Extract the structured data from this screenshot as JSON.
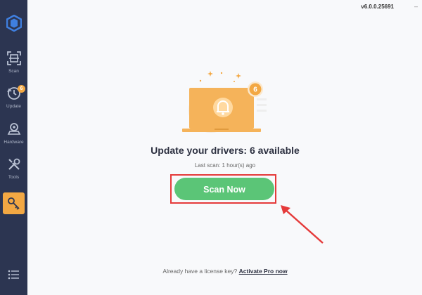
{
  "app": {
    "version": "v6.0.0.25691"
  },
  "sidebar": {
    "items": [
      {
        "label": "Scan",
        "icon": "scan-icon"
      },
      {
        "label": "Update",
        "icon": "update-icon",
        "badge": "6"
      },
      {
        "label": "Hardware",
        "icon": "hardware-icon"
      },
      {
        "label": "Tools",
        "icon": "tools-icon"
      },
      {
        "label": "",
        "icon": "key-icon",
        "active": true
      }
    ],
    "menu_icon": "menu-icon"
  },
  "main": {
    "illustration_badge": "6",
    "title": "Update your drivers: 6 available",
    "subtitle": "Last scan: 1 hour(s) ago",
    "scan_button": "Scan Now"
  },
  "footer": {
    "text": "Already have a license key?",
    "link": "Activate Pro now"
  },
  "colors": {
    "sidebar": "#2c3551",
    "accent_orange": "#f3a843",
    "scan_green": "#5bc577",
    "highlight_red": "#e53a3a"
  }
}
